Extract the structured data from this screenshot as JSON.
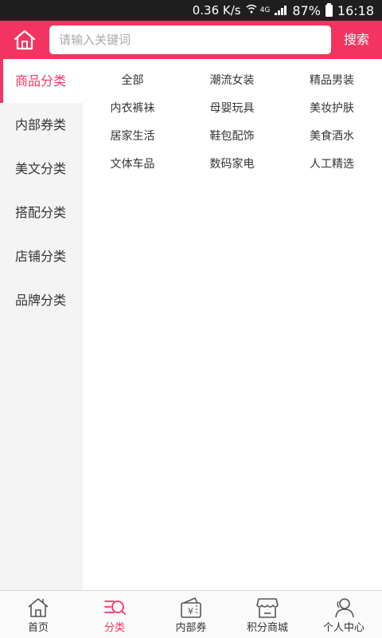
{
  "status_bar": {
    "net_speed": "0.36 K/s",
    "network_type": "4G",
    "battery": "87%",
    "time": "16:18"
  },
  "header": {
    "home_icon": "home-icon",
    "search_placeholder": "请输入关键词",
    "search_button": "搜索",
    "accent_color": "#f43460"
  },
  "sidebar": {
    "items": [
      {
        "label": "商品分类",
        "active": true
      },
      {
        "label": "内部券类",
        "active": false
      },
      {
        "label": "美文分类",
        "active": false
      },
      {
        "label": "搭配分类",
        "active": false
      },
      {
        "label": "店铺分类",
        "active": false
      },
      {
        "label": "品牌分类",
        "active": false
      }
    ]
  },
  "categories": [
    "全部",
    "潮流女装",
    "精品男装",
    "内衣裤袜",
    "母婴玩具",
    "美妆护肤",
    "居家生活",
    "鞋包配饰",
    "美食酒水",
    "文体车品",
    "数码家电",
    "人工精选"
  ],
  "bottom_nav": {
    "items": [
      {
        "label": "首页",
        "icon": "home-outline-icon",
        "active": false
      },
      {
        "label": "分类",
        "icon": "category-search-icon",
        "active": true
      },
      {
        "label": "内部券",
        "icon": "coupon-icon",
        "active": false
      },
      {
        "label": "积分商城",
        "icon": "store-icon",
        "active": false
      },
      {
        "label": "个人中心",
        "icon": "user-icon",
        "active": false
      }
    ]
  }
}
